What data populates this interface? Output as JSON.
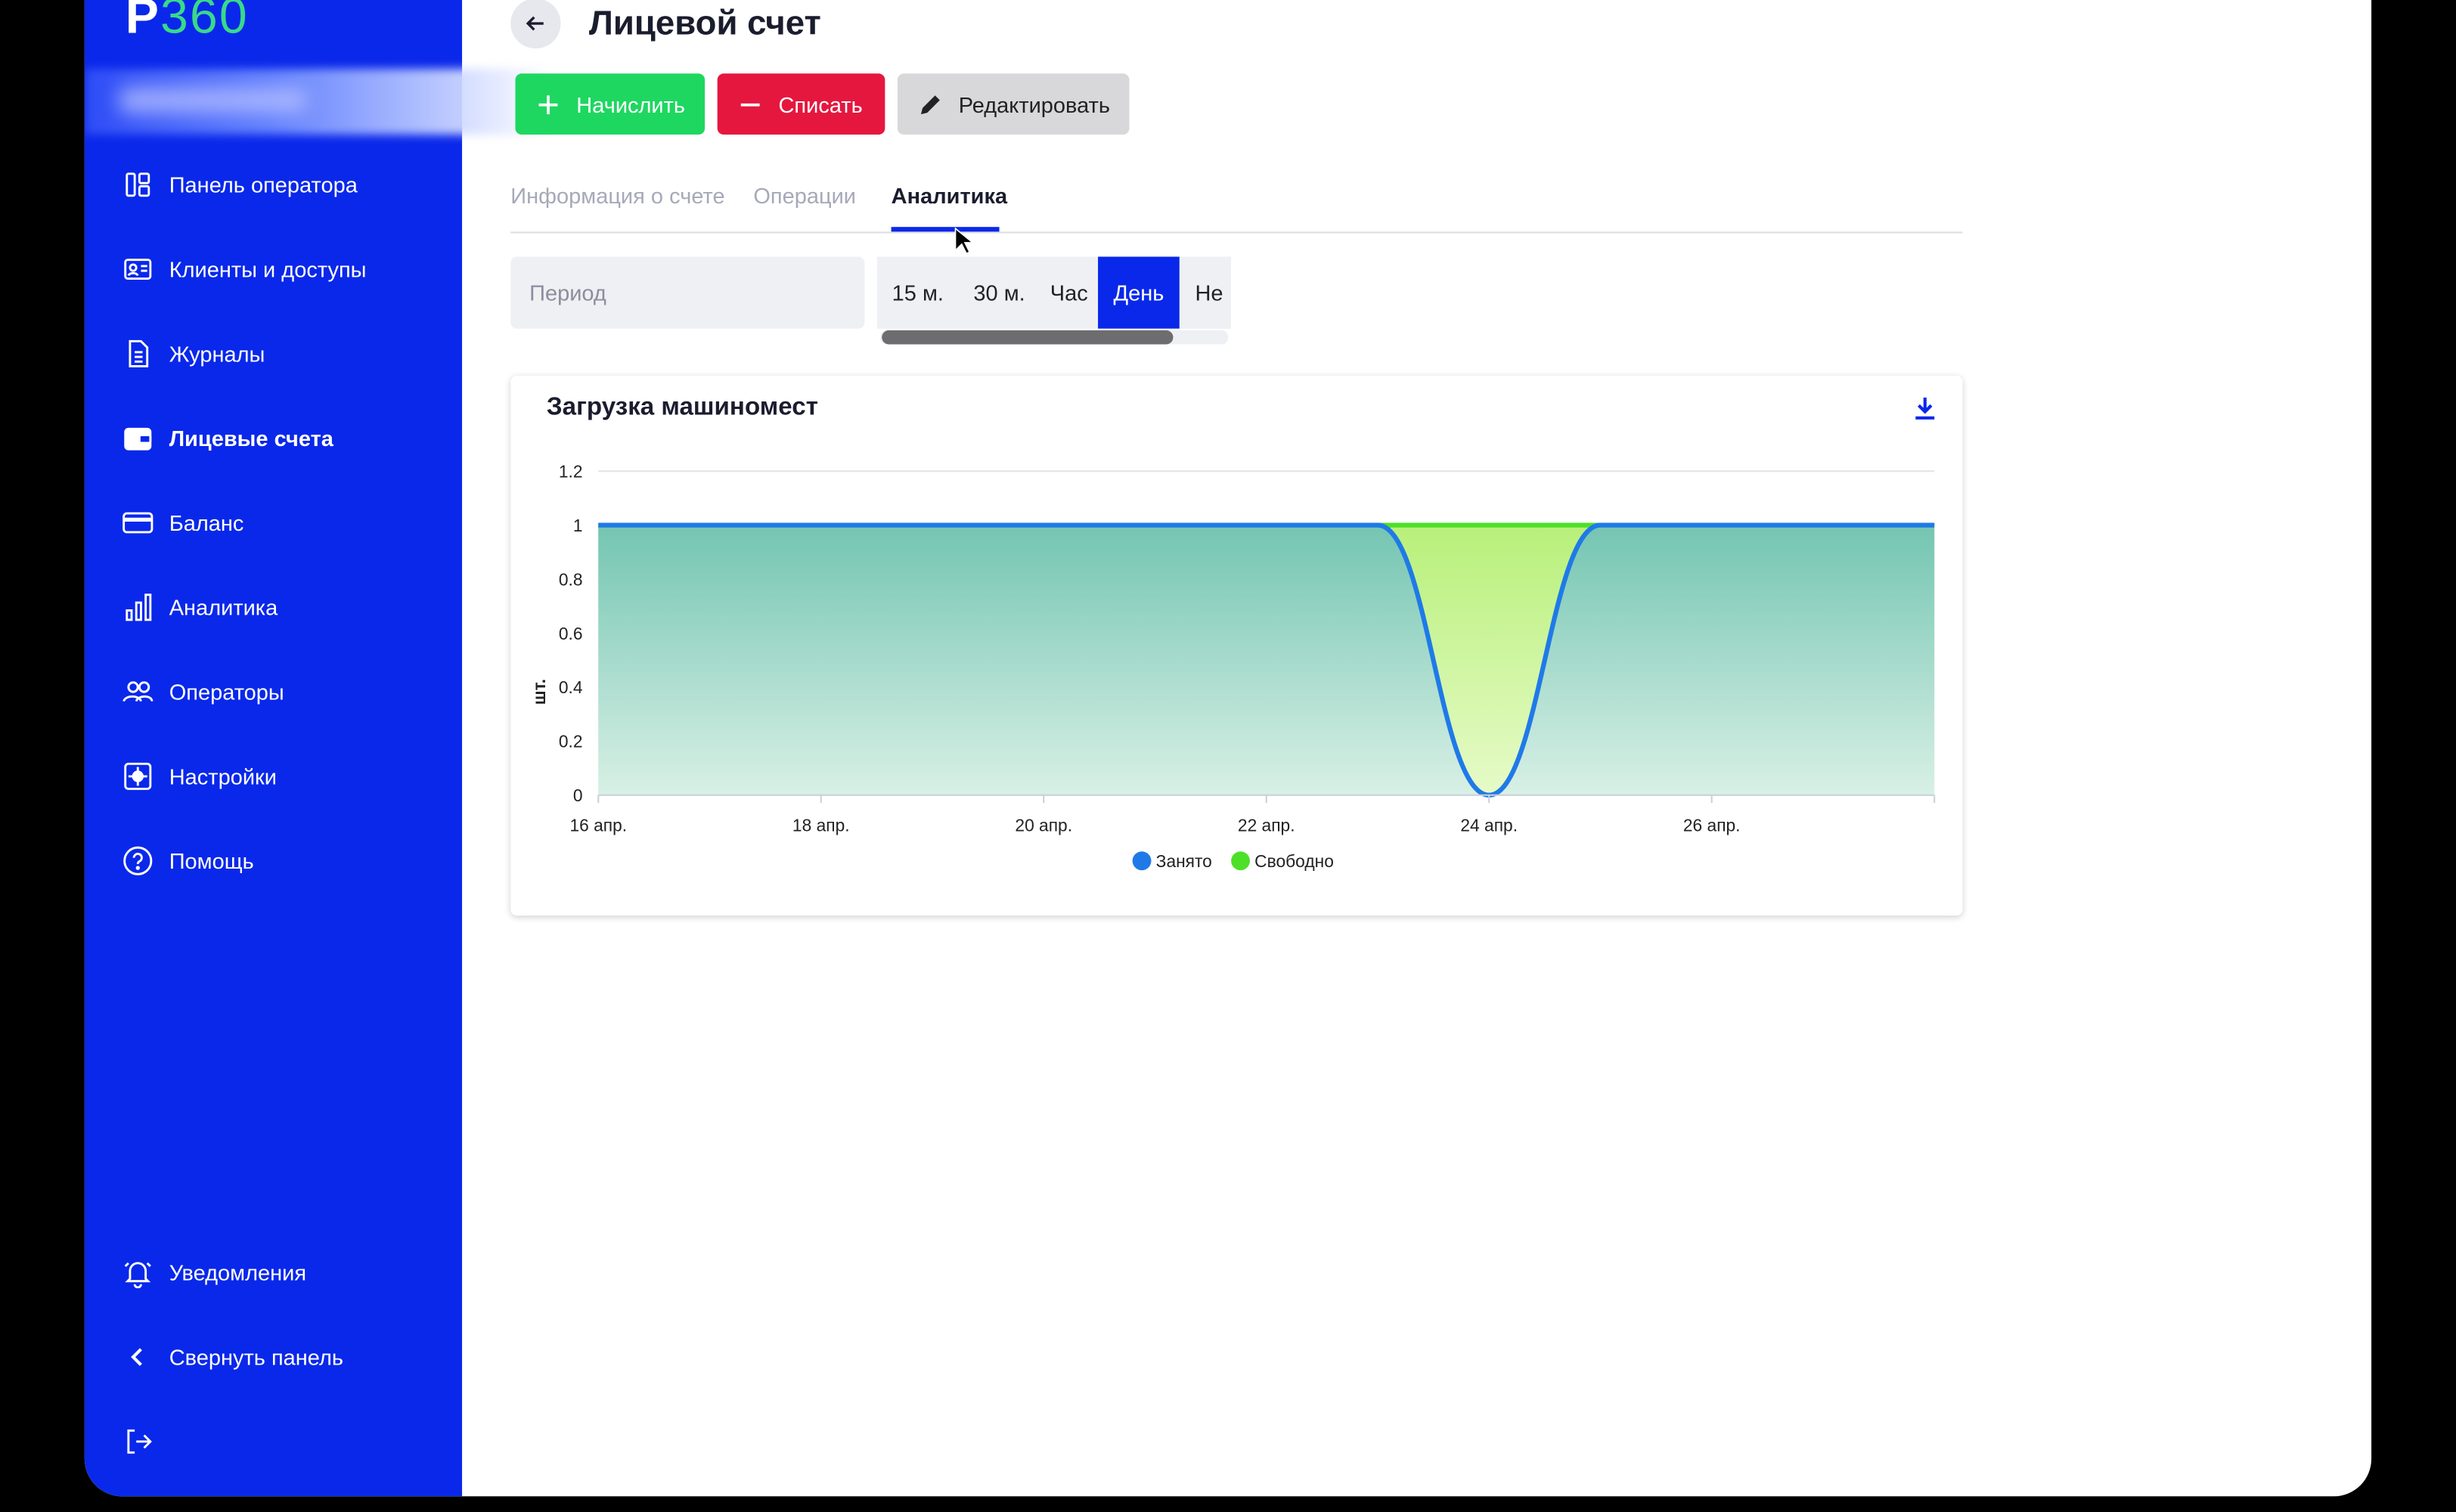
{
  "brand": {
    "logo_letter": "P",
    "logo_num": "360"
  },
  "sidebar": {
    "items": [
      {
        "label": "Панель оператора",
        "icon": "dashboard-icon"
      },
      {
        "label": "Клиенты и доступы",
        "icon": "clients-icon"
      },
      {
        "label": "Журналы",
        "icon": "document-icon"
      },
      {
        "label": "Лицевые счета",
        "icon": "wallet-icon",
        "active": true
      },
      {
        "label": "Баланс",
        "icon": "card-icon"
      },
      {
        "label": "Аналитика",
        "icon": "bar-chart-icon"
      },
      {
        "label": "Операторы",
        "icon": "users-icon"
      },
      {
        "label": "Настройки",
        "icon": "gear-icon"
      },
      {
        "label": "Помощь",
        "icon": "help-icon"
      }
    ],
    "bottom": {
      "notifications": "Уведомления",
      "collapse": "Свернуть панель"
    }
  },
  "header": {
    "title": "Лицевой счет",
    "buttons": {
      "add": "Начислить",
      "subtract": "Списать",
      "edit": "Редактировать"
    }
  },
  "tabs": [
    {
      "label": "Информация о счете"
    },
    {
      "label": "Операции"
    },
    {
      "label": "Аналитика",
      "active": true
    }
  ],
  "filters": {
    "period_placeholder": "Период",
    "intervals": [
      "15 м.",
      "30 м.",
      "Час",
      "День",
      "Не"
    ],
    "selected_interval": "День"
  },
  "colors": {
    "accent": "#0a28ea",
    "add": "#1ed760",
    "subtract": "#e5173f",
    "occupied": "#1f7ae8",
    "free": "#4de028"
  },
  "chart_data": {
    "type": "area",
    "title": "Загрузка машиномест",
    "ylabel": "шт.",
    "ylim": [
      0,
      1.2
    ],
    "yticks": [
      "0",
      "0.2",
      "0.4",
      "0.6",
      "0.8",
      "1",
      "1.2"
    ],
    "xticks": [
      "16 апр.",
      "18 апр.",
      "20 апр.",
      "22 апр.",
      "24 апр.",
      "26 апр."
    ],
    "x": [
      "16 апр.",
      "17 апр.",
      "18 апр.",
      "19 апр.",
      "20 апр.",
      "21 апр.",
      "22 апр.",
      "23 апр.",
      "24 апр.",
      "25 апр.",
      "26 апр.",
      "27 апр.",
      "28 апр."
    ],
    "series": [
      {
        "name": "Занято",
        "color": "#1f7ae8",
        "values": [
          1,
          1,
          1,
          1,
          1,
          1,
          1,
          1,
          0,
          1,
          1,
          1,
          1
        ]
      },
      {
        "name": "Свободно",
        "color": "#4de028",
        "values": [
          0,
          0,
          0,
          0,
          0,
          0,
          0,
          0,
          1,
          0,
          0,
          0,
          0
        ]
      }
    ],
    "legend": "bottom",
    "grid": true
  }
}
